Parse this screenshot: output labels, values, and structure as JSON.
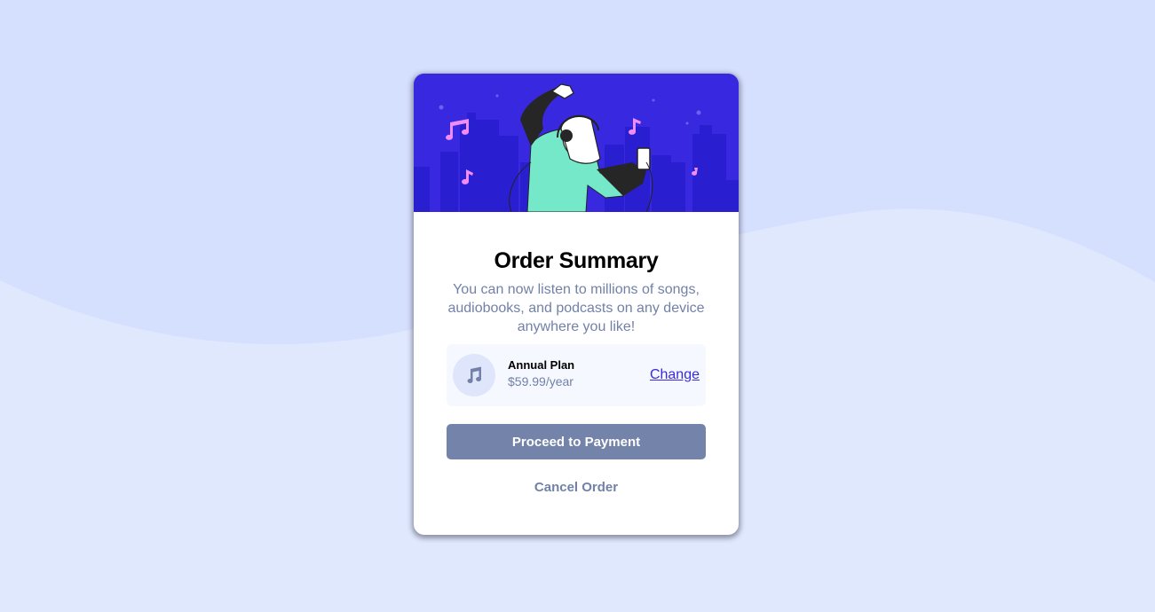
{
  "colors": {
    "page_background": "#e0e8fe",
    "wave": "#d5dffe",
    "hero_background": "#3829e0",
    "accent": "#3829e0",
    "button": "#7483a9",
    "muted_text": "#7281a8",
    "plan_box": "#f5f8ff"
  },
  "hero": {
    "illustration": "person-dancing-with-headphones-city-skyline"
  },
  "summary": {
    "title": "Order Summary",
    "description": "You can now listen to millions of songs, audiobooks, and podcasts on any device anywhere you like!"
  },
  "plan": {
    "icon": "music-note-icon",
    "name": "Annual Plan",
    "price": "$59.99/year",
    "change_label": "Change"
  },
  "actions": {
    "proceed_label": "Proceed to Payment",
    "cancel_label": "Cancel Order"
  }
}
